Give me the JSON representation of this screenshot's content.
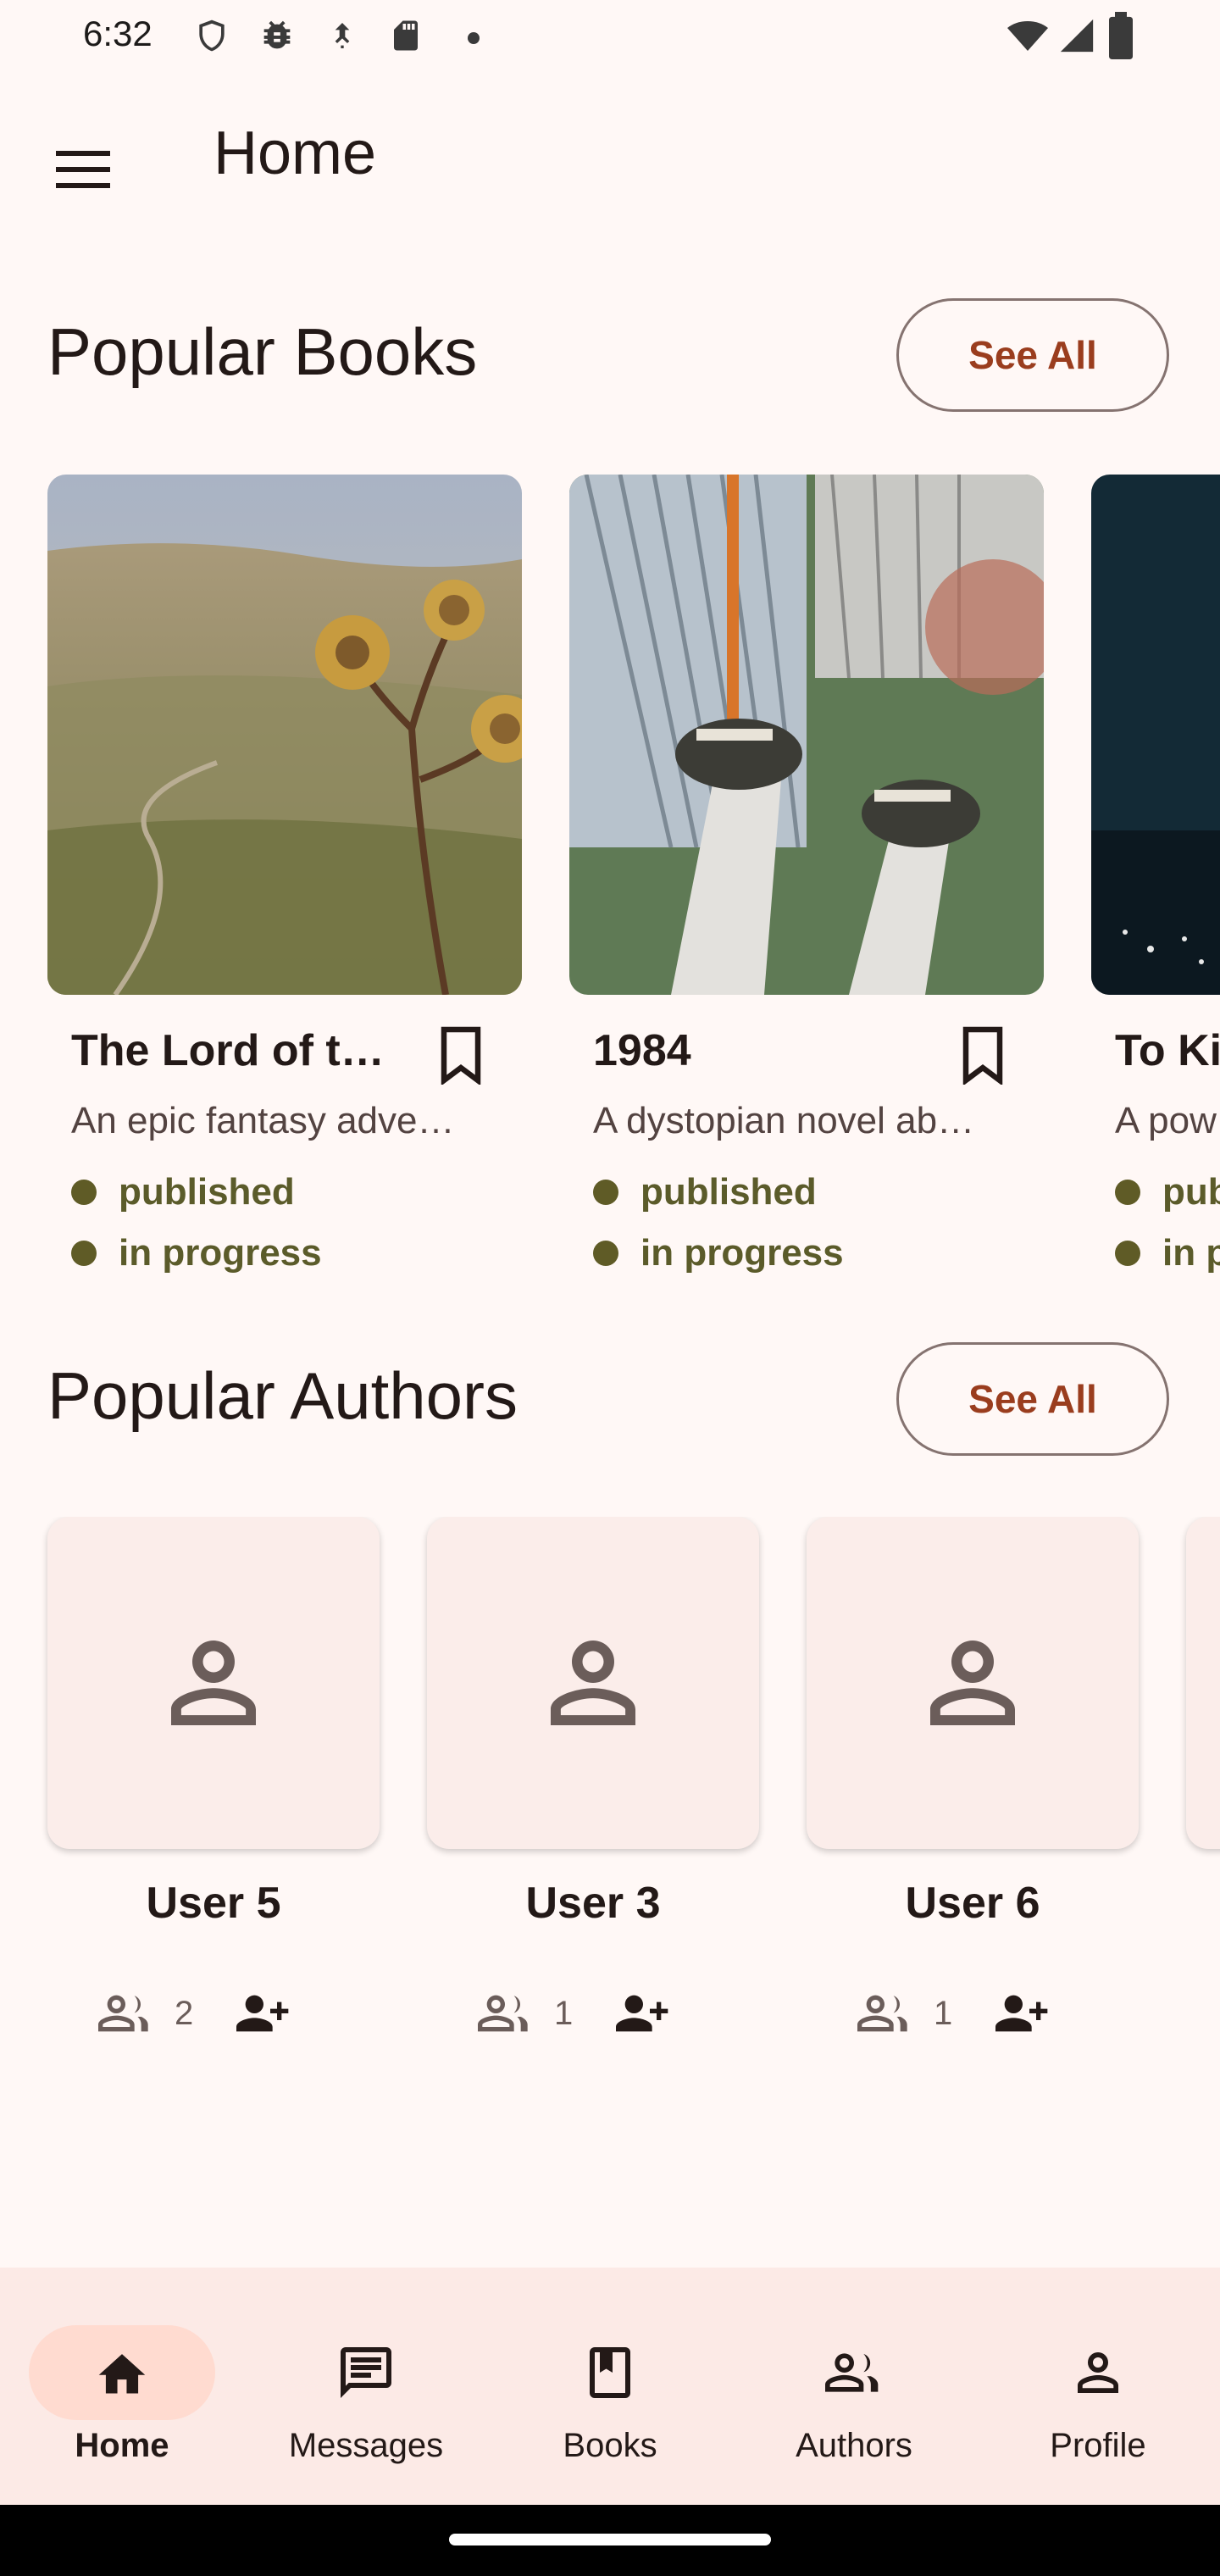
{
  "status_bar": {
    "time": "6:32"
  },
  "app_bar": {
    "title": "Home"
  },
  "popular_books": {
    "title": "Popular Books",
    "see_all": "See All",
    "books": [
      {
        "title": "The Lord of th…",
        "description": "An epic fantasy adve…",
        "tags": [
          "published",
          "in progress"
        ]
      },
      {
        "title": "1984",
        "description": "A dystopian novel ab…",
        "tags": [
          "published",
          "in progress"
        ]
      },
      {
        "title": "To Ki",
        "description": "A pow",
        "tags": [
          "pub",
          "in p"
        ]
      }
    ]
  },
  "popular_authors": {
    "title": "Popular Authors",
    "see_all": "See All",
    "authors": [
      {
        "name": "User 5",
        "followers": "2"
      },
      {
        "name": "User 3",
        "followers": "1"
      },
      {
        "name": "User 6",
        "followers": "1"
      }
    ]
  },
  "bottom_nav": {
    "items": [
      {
        "label": "Home",
        "icon": "home-icon",
        "active": true
      },
      {
        "label": "Messages",
        "icon": "messages-icon",
        "active": false
      },
      {
        "label": "Books",
        "icon": "book-icon",
        "active": false
      },
      {
        "label": "Authors",
        "icon": "people-icon",
        "active": false
      },
      {
        "label": "Profile",
        "icon": "person-icon",
        "active": false
      }
    ]
  },
  "colors": {
    "background": "#FFF8F6",
    "accent": "#9A3D1E",
    "nav_active": "#FFDBD0",
    "nav_background": "#FCEAE6",
    "tag_dot": "#5F5B26"
  }
}
